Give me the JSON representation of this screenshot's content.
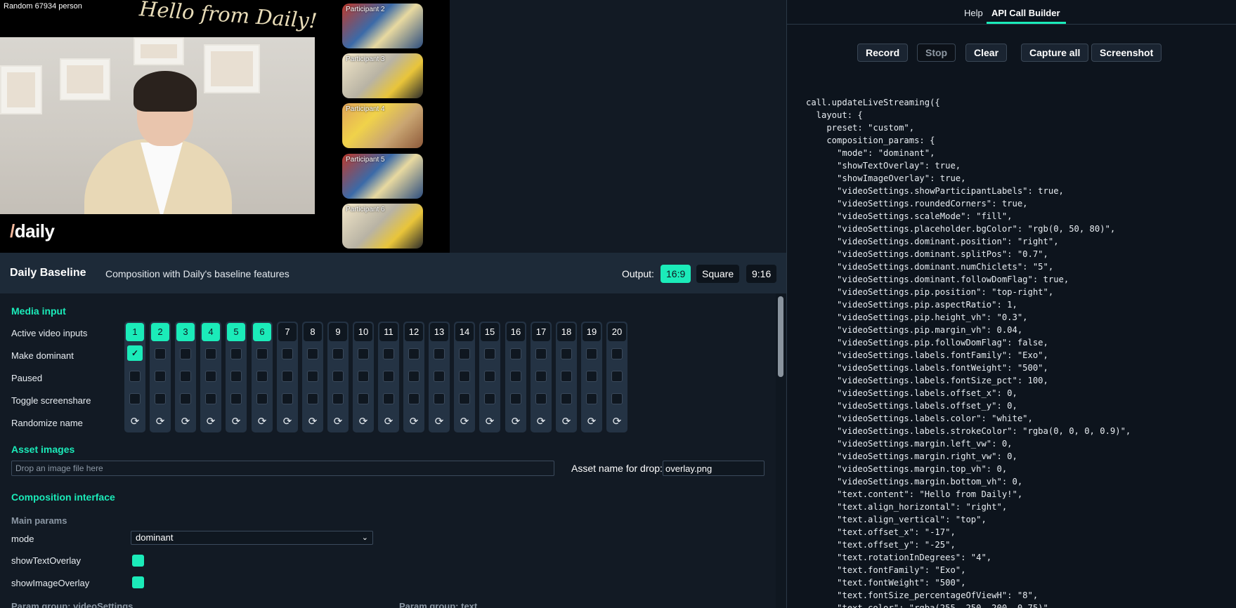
{
  "video": {
    "participant_label": "Random 67934 person",
    "overlay_text": "Hello from Daily!",
    "logo_slash": "/",
    "logo_text": "daily",
    "chiclets": [
      "Participant 2",
      "Participant 3",
      "Participant 4",
      "Participant 5",
      "Participant 6"
    ]
  },
  "composition": {
    "title": "Daily Baseline",
    "description": "Composition with Daily's baseline features",
    "output_label": "Output:",
    "output_options": [
      "16:9",
      "Square",
      "9:16"
    ],
    "output_selected": "16:9"
  },
  "media_input": {
    "title": "Media input",
    "row_labels": [
      "Active video inputs",
      "Make dominant",
      "Paused",
      "Toggle screenshare",
      "Randomize name"
    ],
    "inputs": [
      "1",
      "2",
      "3",
      "4",
      "5",
      "6",
      "7",
      "8",
      "9",
      "10",
      "11",
      "12",
      "13",
      "14",
      "15",
      "16",
      "17",
      "18",
      "19",
      "20"
    ],
    "active_count": 6,
    "dominant_index": 1,
    "check_glyph": "✓",
    "randomize_glyph": "⟳"
  },
  "assets": {
    "title": "Asset images",
    "drop_placeholder": "Drop an image file here",
    "asset_name_label": "Asset name for drop:",
    "asset_name_value": "overlay.png"
  },
  "interface": {
    "title": "Composition interface",
    "main_params": "Main params",
    "mode_label": "mode",
    "mode_value": "dominant",
    "show_text_overlay_label": "showTextOverlay",
    "show_image_overlay_label": "showImageOverlay",
    "param_group_1": "Param group: videoSettings",
    "param_group_2": "Param group: text"
  },
  "right_panel": {
    "tabs": [
      "Help",
      "API Call Builder"
    ],
    "active_tab": "API Call Builder",
    "buttons": [
      "Record",
      "Stop",
      "Clear",
      "Capture all",
      "Screenshot"
    ],
    "code": "call.updateLiveStreaming({\n  layout: {\n    preset: \"custom\",\n    composition_params: {\n      \"mode\": \"dominant\",\n      \"showTextOverlay\": true,\n      \"showImageOverlay\": true,\n      \"videoSettings.showParticipantLabels\": true,\n      \"videoSettings.roundedCorners\": true,\n      \"videoSettings.scaleMode\": \"fill\",\n      \"videoSettings.placeholder.bgColor\": \"rgb(0, 50, 80)\",\n      \"videoSettings.dominant.position\": \"right\",\n      \"videoSettings.dominant.splitPos\": \"0.7\",\n      \"videoSettings.dominant.numChiclets\": \"5\",\n      \"videoSettings.dominant.followDomFlag\": true,\n      \"videoSettings.pip.position\": \"top-right\",\n      \"videoSettings.pip.aspectRatio\": 1,\n      \"videoSettings.pip.height_vh\": \"0.3\",\n      \"videoSettings.pip.margin_vh\": 0.04,\n      \"videoSettings.pip.followDomFlag\": false,\n      \"videoSettings.labels.fontFamily\": \"Exo\",\n      \"videoSettings.labels.fontWeight\": \"500\",\n      \"videoSettings.labels.fontSize_pct\": 100,\n      \"videoSettings.labels.offset_x\": 0,\n      \"videoSettings.labels.offset_y\": 0,\n      \"videoSettings.labels.color\": \"white\",\n      \"videoSettings.labels.strokeColor\": \"rgba(0, 0, 0, 0.9)\",\n      \"videoSettings.margin.left_vw\": 0,\n      \"videoSettings.margin.right_vw\": 0,\n      \"videoSettings.margin.top_vh\": 0,\n      \"videoSettings.margin.bottom_vh\": 0,\n      \"text.content\": \"Hello from Daily!\",\n      \"text.align_horizontal\": \"right\",\n      \"text.align_vertical\": \"top\",\n      \"text.offset_x\": \"-17\",\n      \"text.offset_y\": \"-25\",\n      \"text.rotationInDegrees\": \"4\",\n      \"text.fontFamily\": \"Exo\",\n      \"text.fontWeight\": \"500\",\n      \"text.fontSize_percentageOfViewH\": \"8\",\n      \"text.color\": \"rgba(255, 250, 200, 0.75)\","
  },
  "colors": {
    "accent": "#1bebb9",
    "panel_bg": "#121a24",
    "header_bg": "#1d2a38",
    "code_bg": "#0d141d"
  }
}
